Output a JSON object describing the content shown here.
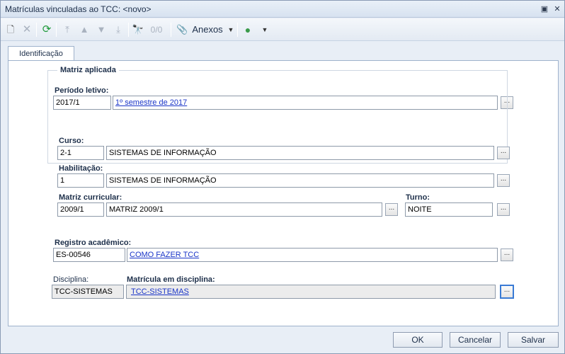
{
  "window": {
    "title": "Matrículas vinculadas ao TCC: <novo>"
  },
  "toolbar": {
    "record_counter": "0/0",
    "anexos_label": "Anexos"
  },
  "tabs": [
    {
      "label": "Identificação"
    }
  ],
  "periodo_letivo": {
    "label": "Período letivo:",
    "code": "2017/1",
    "description": "1º semestre de 2017"
  },
  "matriz_aplicada": {
    "title": "Matriz aplicada",
    "curso": {
      "label": "Curso:",
      "code": "2-1",
      "description": "SISTEMAS DE INFORMAÇÃO"
    },
    "habilitacao": {
      "label": "Habilitação:",
      "code": "1",
      "description": "SISTEMAS DE INFORMAÇÃO"
    },
    "matriz_curricular": {
      "label": "Matriz curricular:",
      "code": "2009/1",
      "description": "MATRIZ 2009/1"
    },
    "turno": {
      "label": "Turno:",
      "value": "NOITE"
    }
  },
  "registro_academico": {
    "label": "Registro acadêmico:",
    "code": "ES-00546",
    "description": "COMO FAZER TCC"
  },
  "disciplina": {
    "label": "Disciplina:",
    "value": "TCC-SISTEMAS"
  },
  "matricula_disciplina": {
    "label": "Matrícula em disciplina:",
    "value": "TCC-SISTEMAS"
  },
  "lookup_label": "...",
  "buttons": {
    "ok": "OK",
    "cancel": "Cancelar",
    "save": "Salvar"
  }
}
